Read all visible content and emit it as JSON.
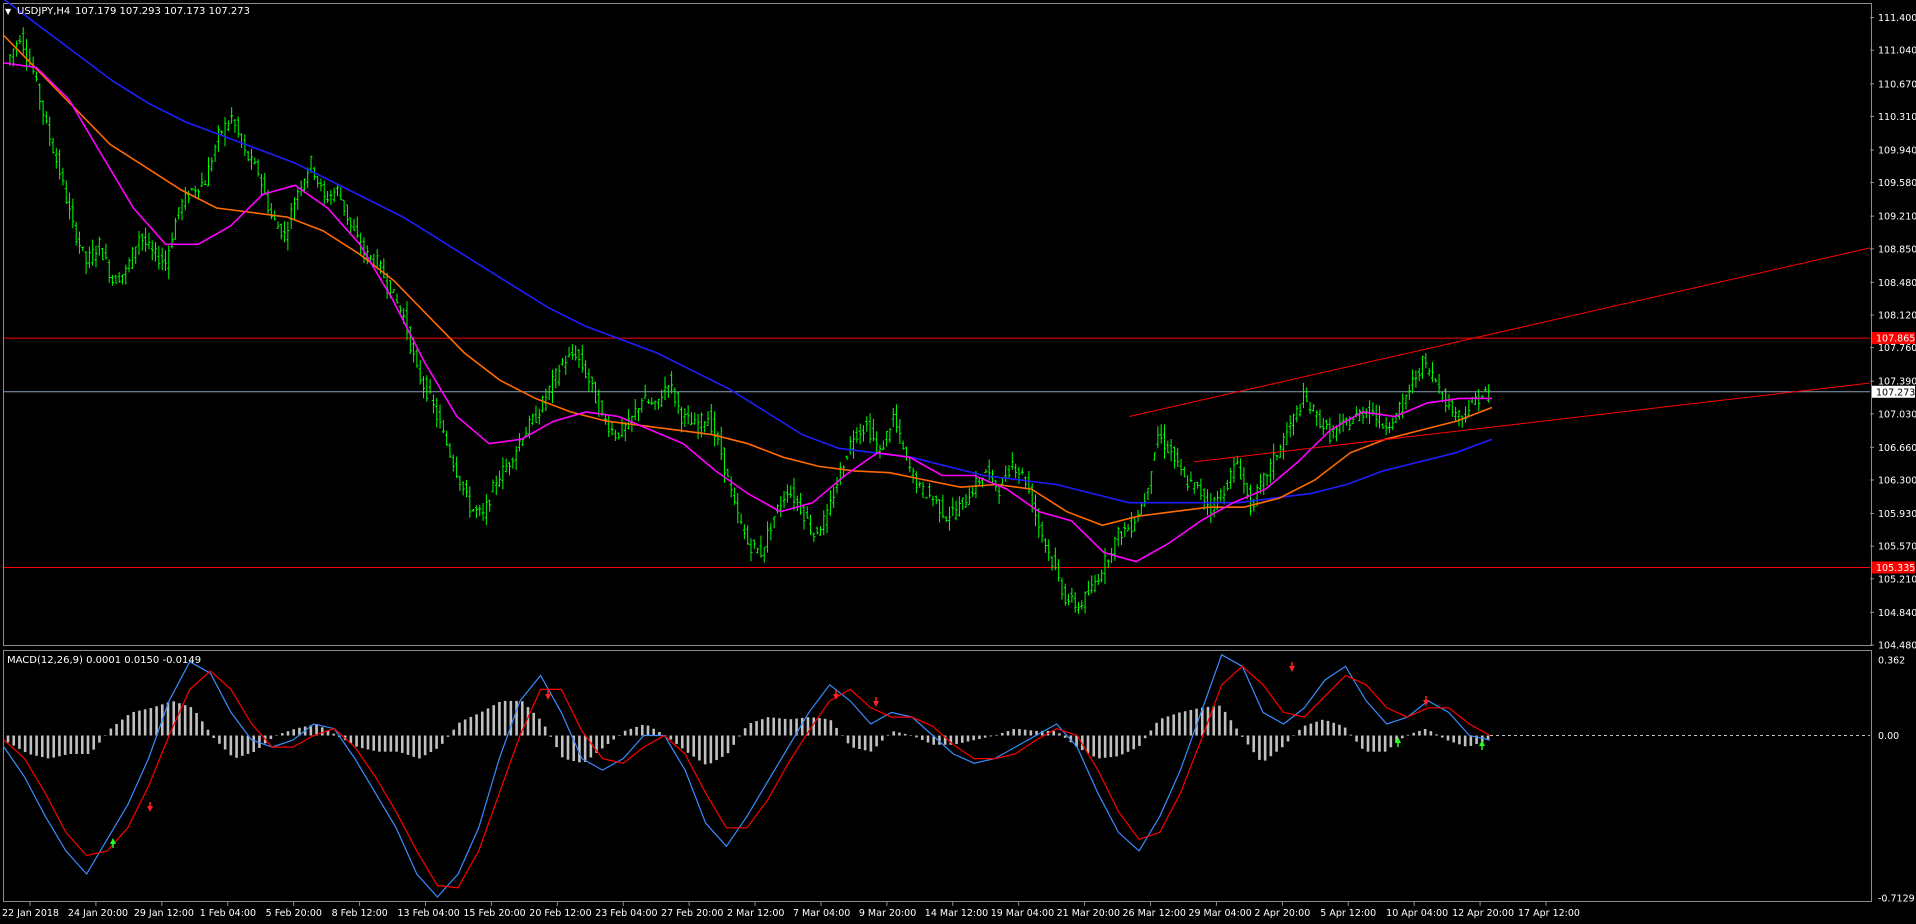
{
  "window": {
    "menu_glyph": "▼",
    "title": "USDJPY,H4",
    "ohlc": "107.179 107.293 107.173 107.273"
  },
  "colors": {
    "background": "#000000",
    "frame": "#8c8c8c",
    "candle": "#00ff00",
    "ma_blue": "#1e1eff",
    "ma_orange": "#ff6a00",
    "ma_magenta": "#ff00ff",
    "hline": "#ff0000",
    "price_line": "#8aa0b8",
    "macd_hist": "#c0c0c0",
    "macd_main": "#3a8cff",
    "macd_signal": "#ff0000",
    "arrow_down": "#ff2020",
    "arrow_up": "#20ff20"
  },
  "chart_data": [
    {
      "type": "candlestick",
      "symbol": "USDJPY",
      "timeframe": "H4",
      "price_axis_ticks": [
        "111.400",
        "111.040",
        "110.670",
        "110.310",
        "109.940",
        "109.580",
        "109.210",
        "108.850",
        "108.480",
        "108.120",
        "107.760",
        "107.390",
        "107.030",
        "106.660",
        "106.300",
        "105.930",
        "105.570",
        "105.210",
        "104.840",
        "104.480"
      ],
      "time_axis_labels": [
        "22 Jan 2018",
        "24 Jan 20:00",
        "29 Jan 12:00",
        "1 Feb 04:00",
        "5 Feb 20:00",
        "8 Feb 12:00",
        "13 Feb 04:00",
        "15 Feb 20:00",
        "20 Feb 12:00",
        "23 Feb 04:00",
        "27 Feb 20:00",
        "2 Mar 12:00",
        "7 Mar 04:00",
        "9 Mar 20:00",
        "14 Mar 12:00",
        "19 Mar 04:00",
        "21 Mar 20:00",
        "26 Mar 12:00",
        "29 Mar 04:00",
        "2 Apr 20:00",
        "5 Apr 12:00",
        "10 Apr 04:00",
        "12 Apr 20:00",
        "17 Apr 12:00"
      ],
      "ylim": [
        104.48,
        111.55
      ],
      "horizontal_levels": [
        {
          "label": "107.865",
          "value": 107.865
        },
        {
          "label": "105.335",
          "value": 105.335
        }
      ],
      "current_price": {
        "label": "107.273",
        "value": 107.273
      },
      "closes": [
        110.9,
        111.2,
        110.8,
        110.2,
        109.7,
        109.1,
        108.7,
        108.9,
        108.5,
        108.6,
        109.0,
        108.8,
        108.7,
        109.3,
        109.5,
        109.6,
        110.1,
        110.3,
        109.9,
        109.7,
        109.2,
        109.0,
        109.5,
        109.8,
        109.4,
        109.5,
        109.1,
        108.8,
        108.7,
        108.4,
        108.1,
        107.5,
        107.2,
        106.8,
        106.4,
        106.0,
        105.9,
        106.3,
        106.5,
        106.8,
        107.0,
        107.3,
        107.6,
        107.7,
        107.4,
        107.0,
        106.8,
        106.9,
        107.2,
        107.1,
        107.4,
        107.0,
        106.9,
        107.0,
        106.6,
        106.0,
        105.6,
        105.5,
        105.9,
        106.2,
        106.0,
        105.7,
        105.9,
        106.4,
        106.8,
        106.9,
        106.6,
        107.0,
        106.5,
        106.2,
        106.1,
        105.9,
        106.0,
        106.2,
        106.4,
        106.2,
        106.5,
        106.3,
        105.8,
        105.4,
        105.0,
        104.9,
        105.1,
        105.4,
        105.7,
        105.8,
        106.1,
        106.8,
        106.6,
        106.3,
        106.2,
        106.0,
        106.2,
        106.5,
        106.0,
        106.3,
        106.6,
        106.9,
        107.2,
        107.0,
        106.8,
        106.9,
        107.0,
        107.1,
        106.9,
        107.0,
        107.3,
        107.6,
        107.4,
        107.1,
        107.0,
        107.2,
        107.27
      ],
      "indicators": [
        {
          "name": "MA blue",
          "values": [
            111.6,
            111.3,
            111.0,
            110.7,
            110.45,
            110.25,
            110.1,
            109.95,
            109.8,
            109.6,
            109.4,
            109.2,
            108.95,
            108.7,
            108.45,
            108.2,
            108.0,
            107.85,
            107.7,
            107.5,
            107.3,
            107.05,
            106.8,
            106.65,
            106.6,
            106.55,
            106.45,
            106.35,
            106.3,
            106.25,
            106.15,
            106.05,
            106.05,
            106.05,
            106.05,
            106.1,
            106.15,
            106.25,
            106.4,
            106.5,
            106.6,
            106.75
          ]
        },
        {
          "name": "MA orange",
          "values": [
            111.2,
            110.8,
            110.4,
            110.0,
            109.75,
            109.5,
            109.3,
            109.25,
            109.2,
            109.05,
            108.8,
            108.5,
            108.1,
            107.7,
            107.4,
            107.2,
            107.05,
            106.95,
            106.9,
            106.85,
            106.8,
            106.7,
            106.55,
            106.45,
            106.4,
            106.38,
            106.3,
            106.22,
            106.25,
            106.2,
            105.95,
            105.8,
            105.9,
            105.95,
            106.0,
            106.0,
            106.1,
            106.3,
            106.6,
            106.75,
            106.85,
            106.95,
            107.1
          ]
        },
        {
          "name": "MA magenta",
          "values": [
            110.9,
            110.85,
            110.5,
            109.9,
            109.3,
            108.9,
            108.9,
            109.1,
            109.45,
            109.55,
            109.3,
            108.9,
            108.3,
            107.6,
            107.0,
            106.7,
            106.75,
            106.95,
            107.05,
            107.0,
            106.85,
            106.7,
            106.4,
            106.15,
            105.95,
            106.05,
            106.35,
            106.6,
            106.55,
            106.35,
            106.35,
            106.2,
            105.95,
            105.85,
            105.5,
            105.4,
            105.6,
            105.85,
            106.05,
            106.2,
            106.5,
            106.85,
            107.05,
            107.0,
            107.15,
            107.2,
            107.2
          ]
        }
      ],
      "trendlines": [
        {
          "from": [
            "26 Mar 12:00",
            107.0
          ],
          "to": [
            "right edge",
            108.86
          ]
        },
        {
          "from": [
            "29 Mar 04:00",
            106.5
          ],
          "to": [
            "right edge",
            107.37
          ]
        }
      ]
    },
    {
      "type": "histogram+line",
      "name": "MACD(12,26,9)",
      "legend": "MACD(12,26,9) 0.0001 0.0150 -0.0149",
      "axis_ticks": [
        "0.362",
        "0.00",
        "-0.7129"
      ],
      "ylim": [
        -0.7129,
        0.362
      ],
      "series": [
        {
          "name": "MACD main",
          "values": [
            -0.05,
            -0.18,
            -0.35,
            -0.5,
            -0.6,
            -0.45,
            -0.3,
            -0.1,
            0.15,
            0.32,
            0.27,
            0.1,
            -0.02,
            -0.05,
            -0.02,
            0.05,
            0.03,
            -0.1,
            -0.25,
            -0.4,
            -0.6,
            -0.7,
            -0.6,
            -0.4,
            -0.1,
            0.15,
            0.26,
            0.1,
            -0.1,
            -0.15,
            -0.1,
            0.0,
            0.0,
            -0.15,
            -0.38,
            -0.48,
            -0.35,
            -0.2,
            -0.05,
            0.1,
            0.22,
            0.15,
            0.05,
            0.1,
            0.08,
            0.0,
            -0.08,
            -0.12,
            -0.1,
            -0.05,
            0.0,
            0.05,
            -0.05,
            -0.25,
            -0.42,
            -0.5,
            -0.35,
            -0.15,
            0.1,
            0.35,
            0.3,
            0.1,
            0.05,
            0.12,
            0.24,
            0.3,
            0.15,
            0.05,
            0.08,
            0.15,
            0.1,
            0.0,
            -0.02
          ]
        },
        {
          "name": "Signal",
          "values": [
            -0.02,
            -0.1,
            -0.25,
            -0.42,
            -0.52,
            -0.5,
            -0.4,
            -0.22,
            0.0,
            0.2,
            0.28,
            0.2,
            0.05,
            -0.05,
            -0.05,
            0.0,
            0.03,
            -0.05,
            -0.18,
            -0.33,
            -0.5,
            -0.65,
            -0.66,
            -0.5,
            -0.25,
            0.0,
            0.2,
            0.2,
            0.02,
            -0.1,
            -0.12,
            -0.05,
            0.0,
            -0.08,
            -0.25,
            -0.4,
            -0.4,
            -0.28,
            -0.12,
            0.02,
            0.15,
            0.2,
            0.12,
            0.08,
            0.08,
            0.04,
            -0.04,
            -0.1,
            -0.1,
            -0.08,
            -0.02,
            0.03,
            0.0,
            -0.15,
            -0.33,
            -0.45,
            -0.42,
            -0.25,
            -0.02,
            0.22,
            0.3,
            0.22,
            0.1,
            0.08,
            0.17,
            0.26,
            0.22,
            0.12,
            0.08,
            0.12,
            0.12,
            0.05,
            0.0
          ]
        },
        {
          "name": "Histogram",
          "values": [
            -0.03,
            -0.08,
            -0.1,
            -0.08,
            -0.08,
            0.03,
            0.1,
            0.12,
            0.15,
            0.12,
            -0.01,
            -0.1,
            -0.07,
            0.0,
            0.03,
            0.05,
            0.0,
            -0.05,
            -0.07,
            -0.07,
            -0.1,
            -0.05,
            0.06,
            0.1,
            0.15,
            0.15,
            0.06,
            -0.1,
            -0.12,
            -0.05,
            0.02,
            0.05,
            0.0,
            -0.07,
            -0.13,
            -0.08,
            0.05,
            0.08,
            0.07,
            0.08,
            0.07,
            -0.05,
            -0.07,
            0.02,
            0.0,
            -0.04,
            -0.04,
            -0.02,
            0.0,
            0.03,
            0.02,
            0.02,
            -0.05,
            -0.1,
            -0.09,
            -0.05,
            0.07,
            0.1,
            0.12,
            0.13,
            0.0,
            -0.12,
            -0.05,
            0.04,
            0.07,
            0.04,
            -0.07,
            -0.07,
            0.0,
            0.03,
            -0.02,
            -0.05,
            -0.02
          ]
        }
      ]
    }
  ]
}
